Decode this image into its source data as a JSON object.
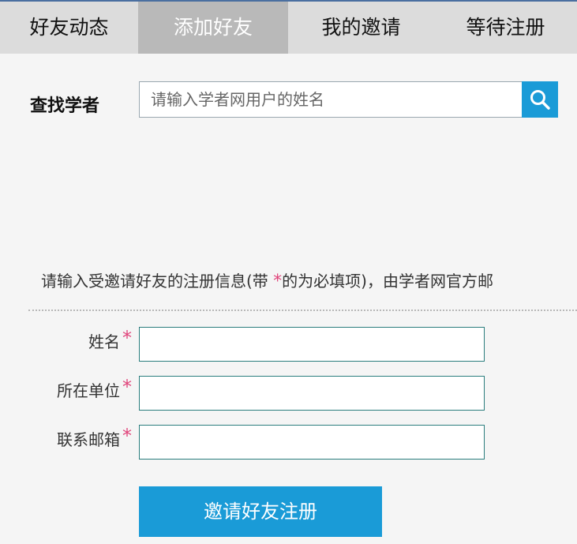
{
  "tabs": [
    {
      "label": "好友动态"
    },
    {
      "label": "添加好友"
    },
    {
      "label": "我的邀请"
    },
    {
      "label": "等待注册"
    }
  ],
  "search": {
    "label": "查找学者",
    "placeholder": "请输入学者网用户的姓名",
    "icon": "search-icon"
  },
  "notice": {
    "prefix": "请输入受邀请好友的注册信息(带 ",
    "star": "*",
    "suffix": "的为必填项)，由学者网官方邮"
  },
  "form": {
    "fields": [
      {
        "label": "姓名",
        "required": "*",
        "value": ""
      },
      {
        "label": "所在单位",
        "required": "*",
        "value": ""
      },
      {
        "label": "联系邮箱",
        "required": "*",
        "value": ""
      }
    ],
    "submit_label": "邀请好友注册"
  },
  "colors": {
    "accent": "#1a9bd7",
    "required": "#e0457b",
    "tab_bar": "#dcdcdc",
    "tab_active": "#b9b9b9"
  }
}
